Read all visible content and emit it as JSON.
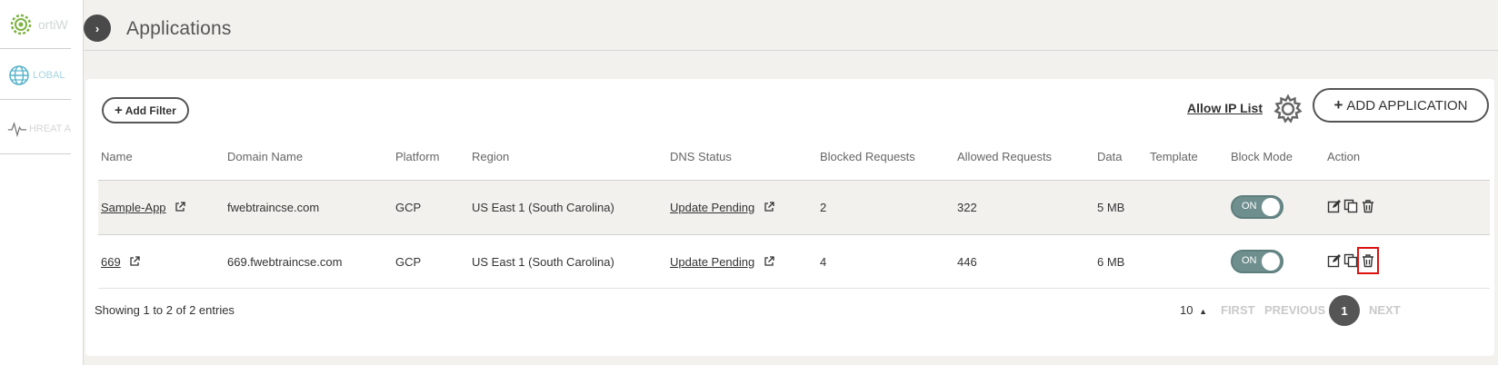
{
  "sidebar": {
    "brand_label": "ortiW",
    "global_label": "LOBAL",
    "threat_label": "HREAT A"
  },
  "header": {
    "title": "Applications",
    "toggle_label": "›"
  },
  "toolbar": {
    "add_filter_label": "Add Filter",
    "allow_ip_label": "Allow IP List",
    "add_application_label": "ADD APPLICATION"
  },
  "table": {
    "columns": [
      "Name",
      "Domain Name",
      "Platform",
      "Region",
      "DNS Status",
      "Blocked Requests",
      "Allowed Requests",
      "Data",
      "Template",
      "Block Mode",
      "Action"
    ],
    "rows": [
      {
        "name": "Sample-App",
        "domain": "fwebtraincse.com",
        "platform": "GCP",
        "region": "US East 1 (South Carolina)",
        "dns_status": "Update Pending",
        "blocked": "2",
        "allowed": "322",
        "data": "5 MB",
        "template": "",
        "block_mode": "ON"
      },
      {
        "name": "669",
        "domain": "669.fwebtraincse.com",
        "platform": "GCP",
        "region": "US East 1 (South Carolina)",
        "dns_status": "Update Pending",
        "blocked": "4",
        "allowed": "446",
        "data": "6 MB",
        "template": "",
        "block_mode": "ON"
      }
    ]
  },
  "footer": {
    "showing": "Showing 1 to 2 of 2 entries",
    "page_size": "10",
    "first": "FIRST",
    "previous": "PREVIOUS",
    "current_page": "1",
    "next": "NEXT"
  },
  "colors": {
    "accent_green": "#7cb342",
    "toggle_on": "#6f8f8f",
    "highlight": "#dd1111"
  },
  "icons": [
    "gear-icon",
    "globe-icon",
    "pulse-icon",
    "external-link-icon",
    "edit-icon",
    "copy-icon",
    "trash-icon",
    "caret-up-icon"
  ]
}
